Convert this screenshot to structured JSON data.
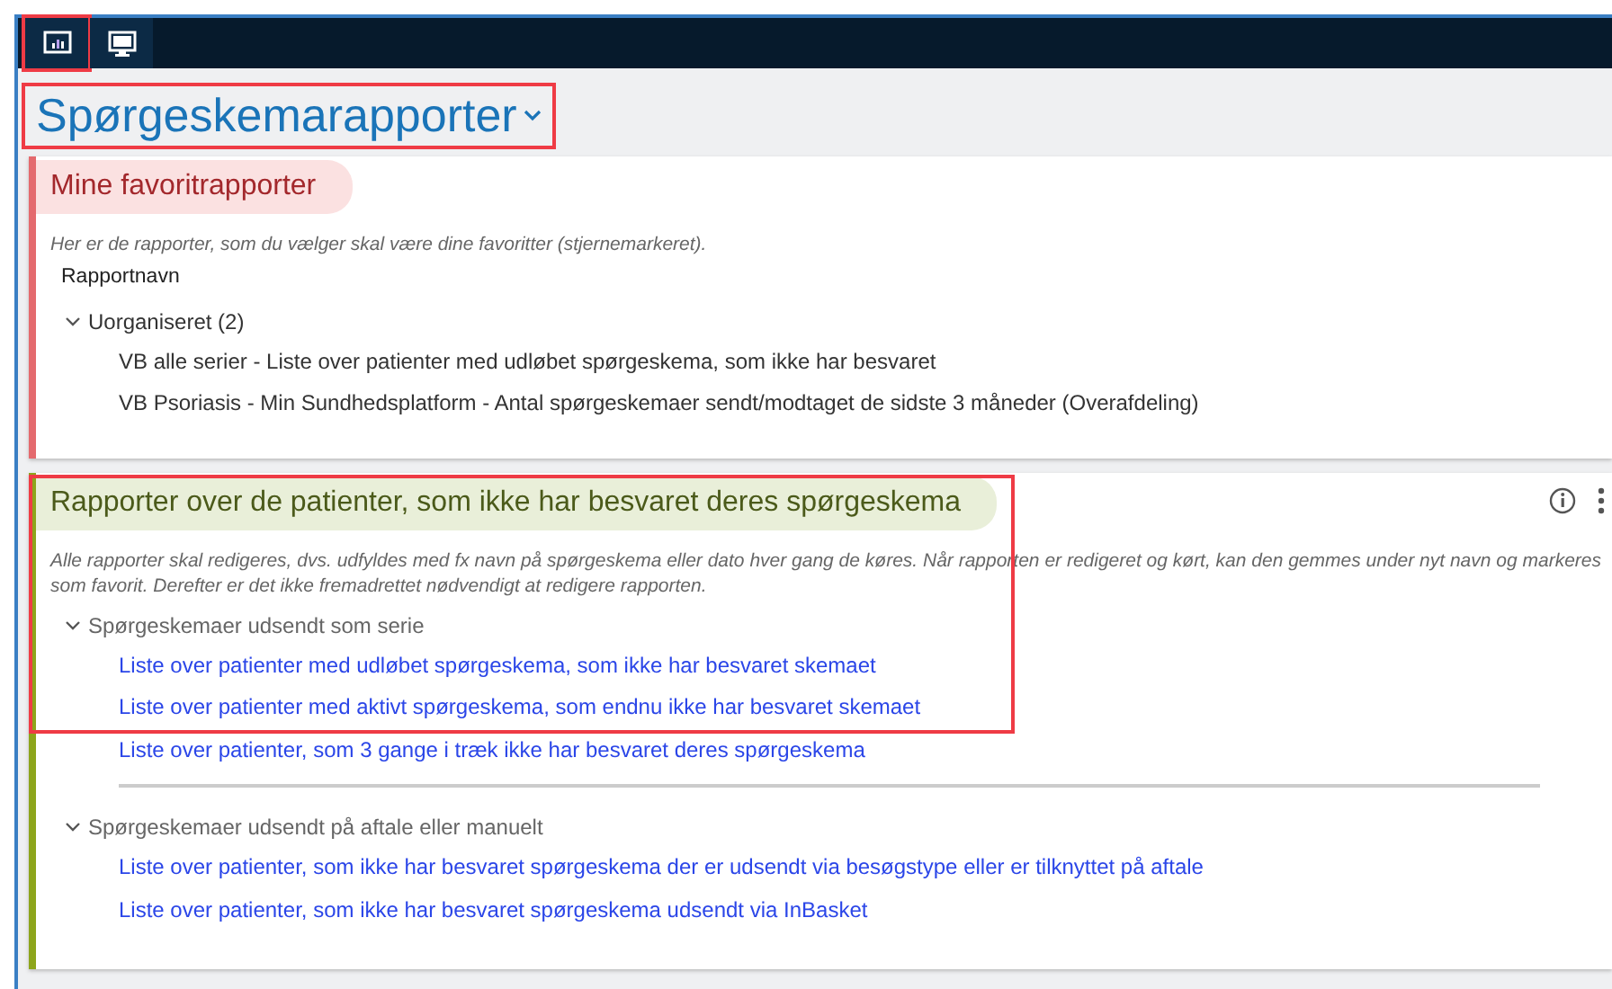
{
  "tabs": [
    {
      "kind": "chart",
      "highlighted": true
    },
    {
      "kind": "monitor",
      "highlighted": false
    }
  ],
  "page_title": {
    "text": "Spørgeskemarapporter",
    "highlighted": true
  },
  "sections": [
    {
      "title": "Mine favoritrapporter",
      "color": "#e46a6e",
      "highlighted": false,
      "has_actions": false,
      "description": "Her er de rapporter, som du vælger skal være dine favoritter (stjernemarkeret).",
      "column_header": "Rapportnavn",
      "groups": [
        {
          "label": "Uorganiseret (2)",
          "kind": "folder",
          "expanded": true,
          "items": [
            {
              "text": "VB alle serier - Liste over patienter med udløbet spørgeskema, som ikke har besvaret",
              "kind": "plain",
              "highlighted": false
            },
            {
              "text": "VB Psoriasis - Min Sundhedsplatform - Antal spørgeskemaer sendt/modtaget de sidste 3 måneder (Overafdeling)",
              "kind": "plain",
              "highlighted": false
            }
          ]
        }
      ]
    },
    {
      "title": "Rapporter over de patienter, som ikke har besvaret deres spørgeskema",
      "color": "#8da51b",
      "highlighted": true,
      "has_actions": true,
      "description": "Alle rapporter skal redigeres, dvs. udfyldes med fx navn på spørgeskema eller dato hver gang de køres. Når rapporten er redigeret og kørt, kan den gemmes under nyt navn og markeres som favorit. Derefter er det ikke fremadrettet nødvendigt at redigere rapporten.",
      "groups": [
        {
          "label": "Spørgeskemaer udsendt som serie",
          "kind": "category",
          "expanded": true,
          "items": [
            {
              "text": "Liste over patienter med udløbet spørgeskema, som ikke har besvaret skemaet",
              "kind": "link",
              "highlighted": true
            },
            {
              "text": "Liste over patienter med aktivt spørgeskema, som endnu ikke har besvaret skemaet",
              "kind": "link",
              "highlighted": true
            },
            {
              "text": "Liste over patienter, som 3 gange i træk ikke har besvaret deres spørgeskema",
              "kind": "link",
              "highlighted": false
            }
          ]
        },
        {
          "label": "Spørgeskemaer udsendt på aftale eller manuelt",
          "kind": "category",
          "expanded": true,
          "items": [
            {
              "text": "Liste over patienter, som ikke har besvaret spørgeskema der er udsendt via besøgstype eller er tilknyttet på aftale",
              "kind": "link",
              "highlighted": false
            },
            {
              "text": "Liste over patienter, som ikke har besvaret spørgeskema udsendt via InBasket",
              "kind": "link",
              "highlighted": false
            }
          ]
        }
      ]
    }
  ]
}
